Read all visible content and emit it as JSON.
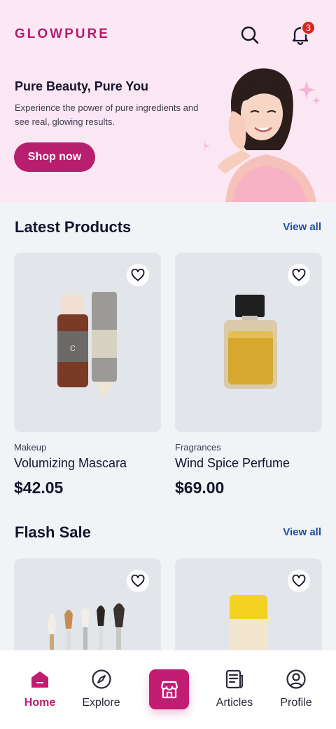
{
  "header": {
    "brand": "GLOWPURE",
    "notification_count": "3"
  },
  "hero": {
    "title": "Pure Beauty, Pure You",
    "subtitle": "Experience the power of pure ingredients and see real, glowing results.",
    "cta_label": "Shop now"
  },
  "latest": {
    "title": "Latest Products",
    "view_all": "View all",
    "products": [
      {
        "category": "Makeup",
        "name": "Volumizing Mascara",
        "price": "$42.05"
      },
      {
        "category": "Fragrances",
        "name": "Wind Spice Perfume",
        "price": "$69.00"
      }
    ]
  },
  "flash": {
    "title": "Flash Sale",
    "view_all": "View all"
  },
  "nav": {
    "items": [
      {
        "label": "Home",
        "icon": "home-icon"
      },
      {
        "label": "Explore",
        "icon": "compass-icon"
      },
      {
        "label": "",
        "icon": "store-icon"
      },
      {
        "label": "Articles",
        "icon": "article-icon"
      },
      {
        "label": "Profile",
        "icon": "profile-icon"
      }
    ]
  },
  "colors": {
    "brand": "#b21e6c",
    "accent": "#b81e6e",
    "link": "#1e4f9c",
    "badge": "#d7261e"
  }
}
